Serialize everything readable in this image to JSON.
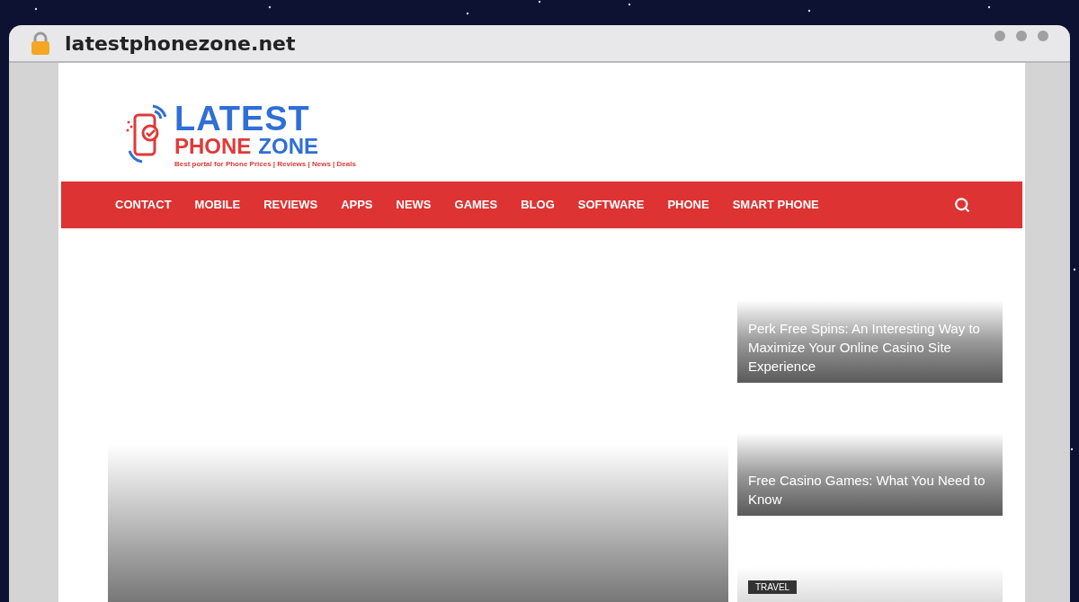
{
  "browser": {
    "url": "latestphonezone.net"
  },
  "logo": {
    "line_1": "LATEST",
    "line_2a": "PHONE",
    "line_2b": "ZONE",
    "tagline": "Best portal for Phone Prices | Reviews | News | Deals"
  },
  "nav": {
    "items": [
      "CONTACT",
      "MOBILE",
      "REVIEWS",
      "APPS",
      "NEWS",
      "GAMES",
      "BLOG",
      "SOFTWARE",
      "PHONE",
      "SMART PHONE"
    ]
  },
  "side_posts": [
    {
      "title": "Perk Free Spins: An Interesting Way to Maximize Your Online Casino Site Experience"
    },
    {
      "title": "Free Casino Games: What You Need to Know"
    },
    {
      "tag": "TRAVEL"
    }
  ]
}
